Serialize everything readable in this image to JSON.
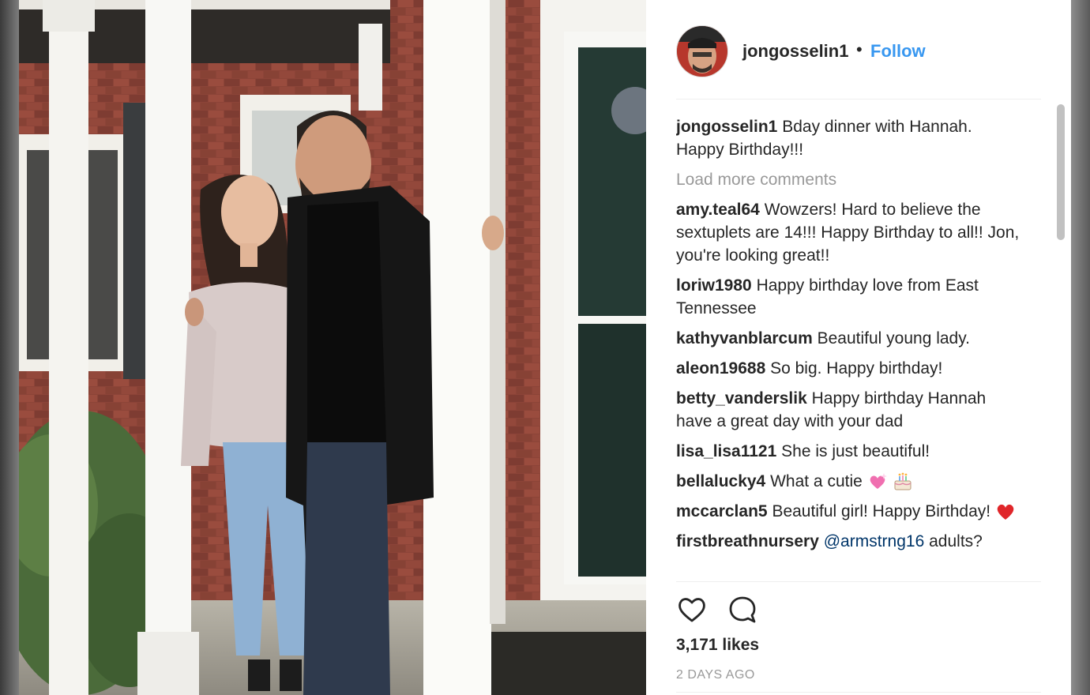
{
  "post": {
    "author": "jongosselin1",
    "separator": "•",
    "follow_label": "Follow",
    "caption_user": "jongosselin1",
    "caption_text": "Bday dinner with Hannah. Happy Birthday!!!",
    "load_more_label": "Load more comments",
    "likes": "3,171 likes",
    "date": "2 DAYS AGO"
  },
  "comments": [
    {
      "user": "amy.teal64",
      "text": "Wowzers! Hard to believe the sextuplets are 14!!! Happy Birthday to all!! Jon, you're looking great!!"
    },
    {
      "user": "loriw1980",
      "text": "Happy birthday love from East Tennessee"
    },
    {
      "user": "kathyvanblarcum",
      "text": "Beautiful young lady."
    },
    {
      "user": "aleon19688",
      "text": "So big. Happy birthday!"
    },
    {
      "user": "betty_vanderslik",
      "text": "Happy birthday Hannah have a great day with your dad"
    },
    {
      "user": "lisa_lisa1121",
      "text": "She is just beautiful!"
    },
    {
      "user": "bellalucky4",
      "text": "What a cutie",
      "emoji": [
        "sparkling-heart",
        "birthday-cake"
      ]
    },
    {
      "user": "mccarclan5",
      "text": "Beautiful girl! Happy Birthday!",
      "emoji": [
        "red-heart"
      ]
    },
    {
      "user": "firstbreathnursery",
      "mention": "@armstrng16",
      "text": "adults?"
    }
  ],
  "icons": [
    "heart-icon",
    "comment-icon"
  ],
  "colors": {
    "link": "#3897f0",
    "muted": "#999999",
    "text": "#262626",
    "mention": "#003569"
  }
}
